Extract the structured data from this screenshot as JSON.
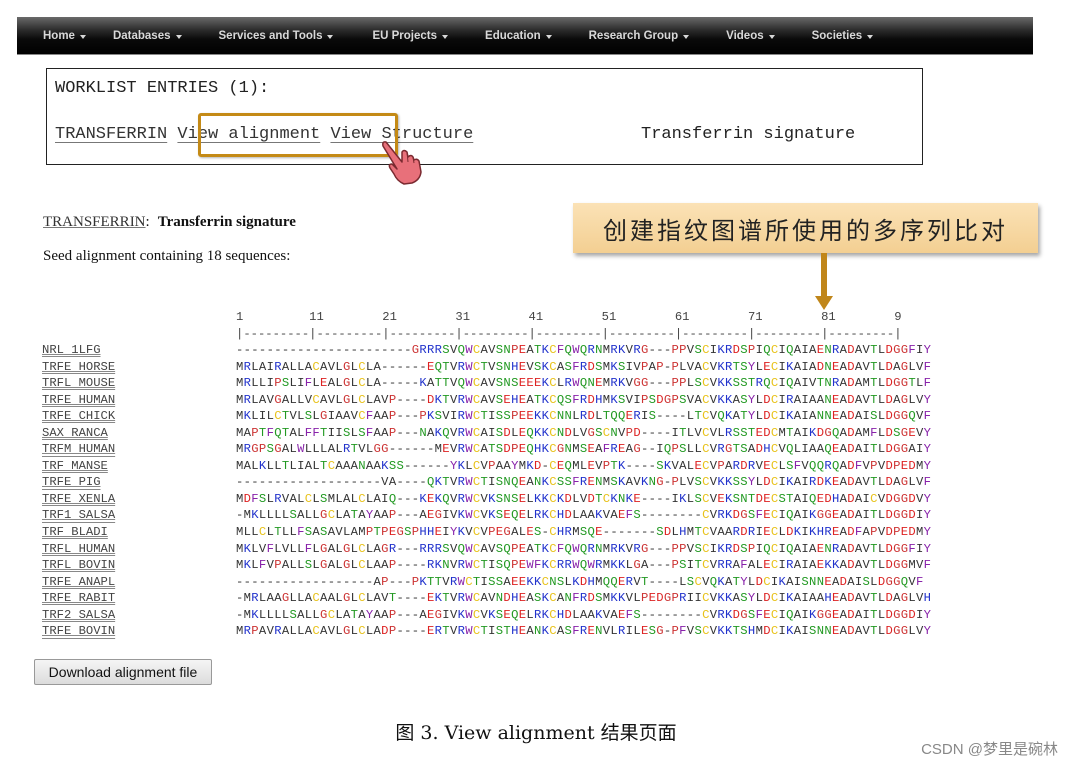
{
  "nav": {
    "items": [
      "Home",
      "Databases",
      "Services and Tools",
      "EU Projects",
      "Education",
      "Research Group",
      "Videos",
      "Societies"
    ]
  },
  "worklist": {
    "title": "WORKLIST ENTRIES (1):",
    "entry_name": "TRANSFERRIN",
    "view_alignment": "View alignment",
    "view_structure": "View Structure",
    "description": "Transferrin signature"
  },
  "callout": {
    "text": "创建指纹图谱所使用的多序列比对"
  },
  "section": {
    "entry_link": "TRANSFERRIN",
    "separator": ":",
    "title": "Transferrin signature",
    "seed_text": "Seed alignment containing 18 sequences:"
  },
  "ruler": {
    "numbers": "1         11        21        31        41        51        61        71        81        9",
    "ticks": "|---------|---------|---------|---------|---------|---------|---------|---------|---------|"
  },
  "alignment": [
    {
      "name": "NRL 1LFG",
      "seq": "-----------------------GRRRSVQWCAVSNPEATKCFQWQRNMRKVRG---PPVSCIKRDSPIQCIQAIAENRADAVTLDGGFIY"
    },
    {
      "name": "TRFE HORSE",
      "seq": "MRLAIRALLACAVLGLCLA------EQTVRWCTVSNHEVSKCASFRDSMKSIVPAP-PLVACVKRTSYLECIKAIADNEADAVTLDAGLVF"
    },
    {
      "name": "TRFL MOUSE",
      "seq": "MRLLIPSLIFLEALGLCLA-----KATTVQWCAVSNSEEEKCLRWQNEMRKVGG---PPLSCVKKSSTRQCIQAIVTNRADAMTLDGGTLF"
    },
    {
      "name": "TRFE HUMAN",
      "seq": "MRLAVGALLVCAVLGLCLAVP----DKTVRWCAVSEHEATKCQSFRDHMKSVIPSDGPSVACVKKASYLDCIRAIAANEADAVTLDAGLVY"
    },
    {
      "name": "TRFE CHICK",
      "seq": "MKLILCTVLSLGIAAVCFAAP---PKSVIRWCTISSPEEKKCNNLRDLTQQERIS----LTCVQKATYLDCIKAIANNEADAISLDGGQVF"
    },
    {
      "name": "SAX RANCA",
      "seq": "MAPTFQTALFFTIISLSFAAP---NAKQVRWCAISDLEQKKCNDLVGSCNVPD----ITLVCVLRSSTEDCMTAIKDGQADAMFLDSGEVY"
    },
    {
      "name": "TRFM HUMAN",
      "seq": "MRGPSGALWLLLALRTVLGG------MEVRWCATSDPEQHKCGNMSEAFREAG--IQPSLLCVRGTSADHCVQLIAAQEADAITLDGGAIY"
    },
    {
      "name": "TRF MANSE",
      "seq": "MALKLLTLIALTCAAANAAKSS------YKLCVPAAYMKD-CEQMLEVPTK----SKVALECVPARDRVECLSFVQQRQADFVPVDPEDMY"
    },
    {
      "name": "TRFE PIG",
      "seq": "-------------------VA----QKTVRWCTISNQEANKCSSFRENMSKAVKNG-PLVSCVKKSSYLDCIKAIRDKEADAVTLDAGLVF"
    },
    {
      "name": "TRFE XENLA",
      "seq": "MDFSLRVALCLSMLALCLAIQ---KEKQVRWCVKSNSELKKCKDLVDTCKNKE----IKLSCVEKSNTDECSTAIQEDHADAICVDGGDVY"
    },
    {
      "name": "TRF1 SALSA",
      "seq": "-MKLLLLSALLGCLATAYAAP---AEGIVKWCVKSEQELRKCHDLAAKVAEFS--------CVRKDGSFECIQAIKGGEADAITLDGGDIY"
    },
    {
      "name": "TRF BLADI",
      "seq": "MLLCLTLLFSASAVLAMPTPEGSPHHEIYKVCVPEGALES-CHRMSQE-------SDLHMTCVAARDRIECLDKIKHREADFAPVDPEDMY"
    },
    {
      "name": "TRFL HUMAN",
      "seq": "MKLVFLVLLFLGALGLCLAGR---RRRSVQWCAVSQPEATKCFQWQRNMRKVRG---PPVSCIKRDSPIQCIQAIAENRADAVTLDGGFIY"
    },
    {
      "name": "TRFL BOVIN",
      "seq": "MKLFVPALLSLGALGLCLAAP----RKNVRWCTISQPEWFKCRRWQWRMKKLGA---PSITCVRRAFALECIRAIAEKKADAVTLDGGMVF"
    },
    {
      "name": "TRFE ANAPL",
      "seq": "------------------AP---PKTTVRWCTISSAEEKKCNSLKDHMQQERVT----LSCVQKATYLDCIKAISNNEADAISLDGGQVF"
    },
    {
      "name": "TRFE RABIT",
      "seq": "-MRLAAGLLACAALGLCLAVT----EKTVRWCAVNDHEASKCANFRDSMKKVLPEDGPRIICVKKASYLDCIKAIAAHEADAVTLDAGLVH"
    },
    {
      "name": "TRF2 SALSA",
      "seq": "-MKLLLLSALLGCLATAYAAP---AEGIVKWCVKSEQELRKCHDLAAKVAEFS--------CVRKDGSFECIQAIKGGEADAITLDGGDIY"
    },
    {
      "name": "TRFE BOVIN",
      "seq": "MRPAVRALLACAVLGLCLADP----ERTVRWCTISTHEANKCASFRENVLRILESG-PFVSCVKKTSHMDCIKAISNNEADAVTLDGGLVY"
    }
  ],
  "download_button": "Download alignment file",
  "caption": "图 3. View alignment 结果页面",
  "watermark": "CSDN @梦里是碗林",
  "colors": {
    "accent_highlight": "#c48a16",
    "callout_bg": "#f7d9a4",
    "arrow": "#c0861a"
  }
}
